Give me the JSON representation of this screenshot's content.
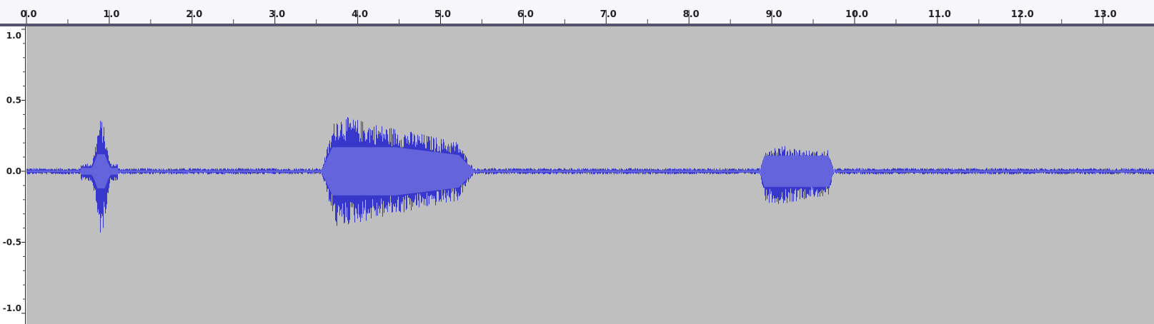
{
  "timeline": {
    "unit": "seconds",
    "start": 0.0,
    "end": 13.0,
    "major_labels": [
      "0.0",
      "1.0",
      "2.0",
      "3.0",
      "4.0",
      "5.0",
      "6.0",
      "7.0",
      "8.0",
      "9.0",
      "10.0",
      "11.0",
      "12.0",
      "13.0"
    ],
    "major_values": [
      0,
      1,
      2,
      3,
      4,
      5,
      6,
      7,
      8,
      9,
      10,
      11,
      12,
      13
    ]
  },
  "vertical_scale": {
    "labels": [
      "1.0",
      "0.5",
      "0.0",
      "-0.5",
      "-1.0"
    ],
    "values": [
      1.0,
      0.5,
      0.0,
      -0.5,
      -1.0
    ]
  },
  "waveform": {
    "color": "#3737cc",
    "rms_color": "#6464dd",
    "background": "#bfbfbf",
    "visible_seconds": [
      0,
      13.25
    ],
    "noise_floor": 0.015,
    "bursts": [
      {
        "start": 0.65,
        "end": 1.1,
        "peak_max": 0.37,
        "peak_min": -0.45,
        "rms": 0.12
      },
      {
        "start": 3.55,
        "end": 5.4,
        "peak_max": 0.4,
        "peak_min": -0.4,
        "rms": 0.17
      },
      {
        "start": 8.85,
        "end": 9.75,
        "peak_max": 0.18,
        "peak_min": -0.23,
        "rms": 0.11
      }
    ]
  }
}
